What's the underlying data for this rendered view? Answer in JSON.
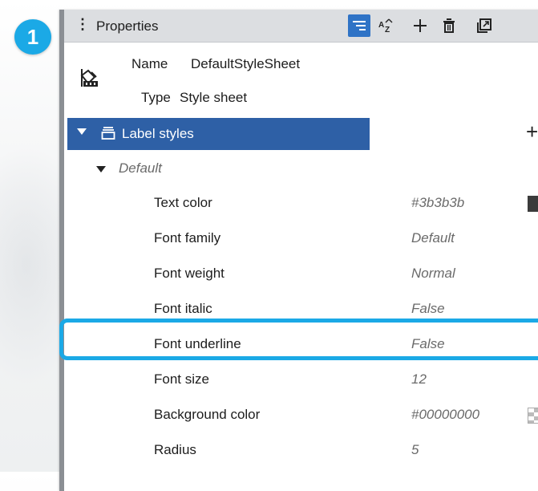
{
  "step_badge": "1",
  "panel": {
    "title": "Properties",
    "toolbar": {
      "grip_icon": "more-vert-icon",
      "categorized_icon": "categorized-view-icon",
      "sort_icon": "sort-az-icon",
      "add_icon": "plus-icon",
      "delete_icon": "trash-icon",
      "popout_icon": "popout-icon"
    },
    "header": {
      "icon": "stylesheet-icon",
      "name_label": "Name",
      "name_value": "DefaultStyleSheet",
      "type_label": "Type",
      "type_value": "Style sheet"
    },
    "group": {
      "label": "Label styles",
      "icon": "layers-icon",
      "add_label": "+"
    },
    "subgroup": {
      "label": "Default"
    },
    "properties": [
      {
        "name": "Text color",
        "value": "#3b3b3b",
        "swatch": "#3b3b3b"
      },
      {
        "name": "Font family",
        "value": "Default"
      },
      {
        "name": "Font weight",
        "value": "Normal"
      },
      {
        "name": "Font italic",
        "value": "False"
      },
      {
        "name": "Font underline",
        "value": "False",
        "highlighted": true
      },
      {
        "name": "Font size",
        "value": "12"
      },
      {
        "name": "Background color",
        "value": "#00000000",
        "swatch": "transparent"
      },
      {
        "name": "Radius",
        "value": "5"
      }
    ]
  },
  "colors": {
    "accent": "#2e60a6",
    "highlight": "#1ba9e6"
  }
}
